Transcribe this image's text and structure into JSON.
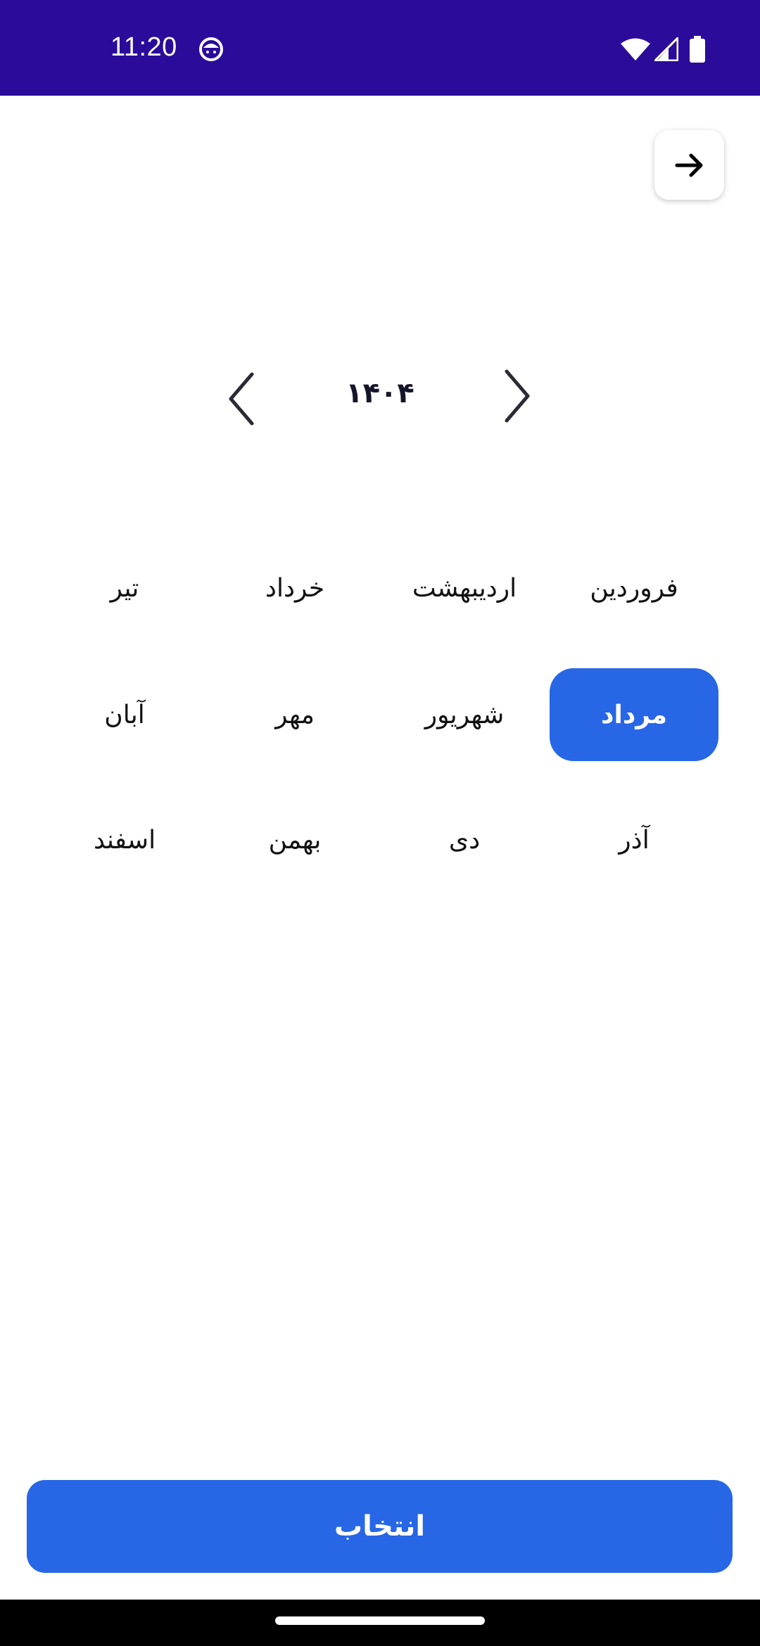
{
  "status_bar": {
    "time": "11:20",
    "background": "#2a0b9a",
    "icons": [
      "app-notification-icon",
      "wifi-icon",
      "signal-icon",
      "battery-icon"
    ]
  },
  "header": {
    "back_icon": "arrow-right-icon"
  },
  "year_nav": {
    "year": "۱۴۰۴",
    "prev_icon": "chevron-left-icon",
    "next_icon": "chevron-right-icon"
  },
  "months": [
    {
      "label": "فروردین",
      "selected": false
    },
    {
      "label": "اردیبهشت",
      "selected": false
    },
    {
      "label": "خرداد",
      "selected": false
    },
    {
      "label": "تیر",
      "selected": false
    },
    {
      "label": "مرداد",
      "selected": true
    },
    {
      "label": "شهریور",
      "selected": false
    },
    {
      "label": "مهر",
      "selected": false
    },
    {
      "label": "آبان",
      "selected": false
    },
    {
      "label": "آذر",
      "selected": false
    },
    {
      "label": "دی",
      "selected": false
    },
    {
      "label": "بهمن",
      "selected": false
    },
    {
      "label": "اسفند",
      "selected": false
    }
  ],
  "footer": {
    "select_label": "انتخاب"
  },
  "colors": {
    "accent": "#2767e6",
    "status_bar": "#2a0b9a",
    "text": "#111111"
  }
}
